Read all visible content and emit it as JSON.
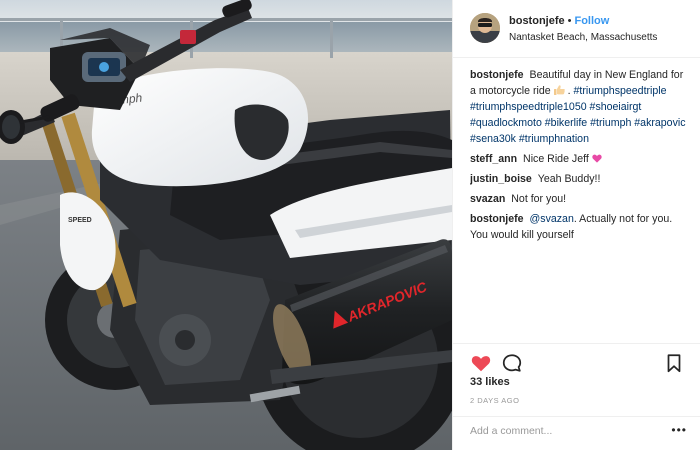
{
  "post": {
    "username": "bostonjefe",
    "follow_label": "Follow",
    "separator": "•",
    "location": "Nantasket Beach, Massachusetts",
    "image_label": "AKRAPOVIC",
    "caption": {
      "username": "bostonjefe",
      "text": "Beautiful day in New England for a motorcycle ride",
      "text_suffix": ".",
      "hashtags": "#triumphspeedtriple #triumphspeedtriple1050 #shoeiairgt #quadlockmoto #bikerlife #triumph #akrapovic #sena30k #triumphnation"
    },
    "comments": [
      {
        "username": "steff_ann",
        "text": "Nice Ride Jeff"
      },
      {
        "username": "justin_boise",
        "text": "Yeah Buddy!!"
      },
      {
        "username": "svazan",
        "text": "Not for you!"
      },
      {
        "username": "bostonjefe",
        "mention": "@svazan",
        "text": ". Actually not for you. You would kill yourself"
      }
    ],
    "likes_label": "33 likes",
    "time_ago": "2 DAYS AGO",
    "add_comment_placeholder": "Add a comment...",
    "more_label": "•••"
  },
  "icons": {
    "heart": "heart-icon",
    "comment": "comment-icon",
    "bookmark": "bookmark-icon",
    "thumbs_up": "thumbs-up-emoji",
    "pink_heart": "heart-emoji"
  },
  "colors": {
    "link_blue": "#3897f0",
    "hashtag": "#003569",
    "like_red": "#ed4956",
    "muted": "#999999"
  }
}
